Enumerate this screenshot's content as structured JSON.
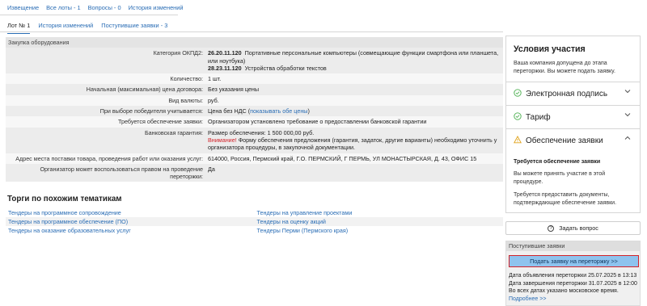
{
  "top_nav": {
    "items": [
      "Извещение",
      "Все лоты - 1",
      "Вопросы - 0",
      "История изменений"
    ]
  },
  "lot_tabs": {
    "items": [
      "Лот № 1",
      "История изменений",
      "Поступившие заявки - 3"
    ],
    "active": 0
  },
  "procurement": {
    "header": "Закупка оборудования",
    "rows": [
      {
        "label": "Категория ОКПД2:",
        "codes": [
          {
            "code": "26.20.11.120",
            "text": "Портативные персональные компьютеры (совмещающие функции смартфона или планшета, или ноутбука)"
          },
          {
            "code": "28.23.11.120",
            "text": "Устройства обработки текстов"
          }
        ]
      },
      {
        "label": "Количество:",
        "value": "1 шт."
      },
      {
        "label": "Начальная (максимальная) цена договора:",
        "value": "Без указания цены"
      },
      {
        "label": "Вид валюты:",
        "value": "руб."
      },
      {
        "label": "При выборе победителя учитывается:",
        "value": "Цена без НДС (",
        "link": "показывать обе цены",
        "after": ")"
      },
      {
        "label": "Требуется обеспечение заявки:",
        "value": "Организатором установлено требование о предоставлении банковской гарантии"
      },
      {
        "label": "Банковская гарантия:",
        "line1": "Размер обеспечения: 1 500 000,00 руб.",
        "warning_word": "Внимание!",
        "warning_text": " Форму обеспечения предложения (гарантия, задаток, другие варианты) необходимо уточнить у организатора процедуры, в закупочной документации."
      },
      {
        "label": "Адрес места поставки товара, проведения работ или оказания услуг:",
        "value": "614000, Россия, Пермский край, Г.О. ПЕРМСКИЙ, Г ПЕРМЬ, УЛ МОНАСТЫРСКАЯ, Д. 43, ОФИС 15"
      },
      {
        "label": "Организатор может воспользоваться правом на проведение переторжки:",
        "value": "Да"
      }
    ]
  },
  "similar": {
    "title": "Торги по похожим тематикам",
    "left": [
      "Тендеры на программное сопровождение",
      "Тендеры на программное обеспечение (ПО)",
      "Тендеры на оказание образовательных услуг"
    ],
    "right": [
      "Тендеры на управление проектами",
      "Тендеры на оценку акций",
      "Тендеры Перми (Пермского края)"
    ]
  },
  "conditions": {
    "title": "Условия участия",
    "description": "Ваша компания допущена до этапа переторжки. Вы можете подать заявку.",
    "sections": [
      {
        "label": "Электронная подпись",
        "status": "ok",
        "icon": "check-circle-icon"
      },
      {
        "label": "Тариф",
        "status": "ok",
        "icon": "check-circle-icon"
      },
      {
        "label": "Обеспечение заявки",
        "status": "warning",
        "icon": "warning-triangle-icon"
      }
    ],
    "security_heading": "Требуется обеспечение заявки",
    "security_text1": "Вы можете принять участие в этой процедуре.",
    "security_text2": "Требуется предоставить документы, подтверждающие обеспечение заявки."
  },
  "ask_button": {
    "label": "Задать вопрос"
  },
  "bids": {
    "header": "Поступившие заявки",
    "button": "Подать заявку на переторжку >>",
    "announce": "Дата объявления переторжки 25.07.2025 в 13:13",
    "end": "Дата завершения переторжки 31.07.2025 в 12:00",
    "tz_note": "Во всех датах указано московское время.",
    "more": "Подробнее >>"
  },
  "colors": {
    "link": "#2a6db5",
    "warning": "#d2232a",
    "ok": "#4caf50",
    "caution": "#e0a21b",
    "primary_button": "#8ec3ee"
  }
}
